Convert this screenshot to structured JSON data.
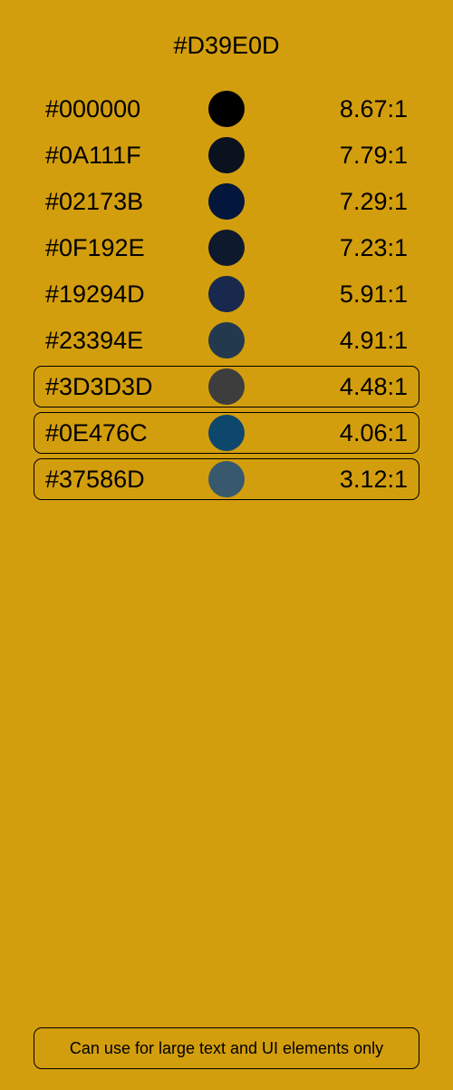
{
  "title": "#D39E0D",
  "background_color": "#D39E0D",
  "rows": [
    {
      "hex": "#000000",
      "color": "#000000",
      "ratio": "8.67:1",
      "outlined": false
    },
    {
      "hex": "#0A111F",
      "color": "#0A111F",
      "ratio": "7.79:1",
      "outlined": false
    },
    {
      "hex": "#02173B",
      "color": "#02173B",
      "ratio": "7.29:1",
      "outlined": false
    },
    {
      "hex": "#0F192E",
      "color": "#0F192E",
      "ratio": "7.23:1",
      "outlined": false
    },
    {
      "hex": "#19294D",
      "color": "#19294D",
      "ratio": "5.91:1",
      "outlined": false
    },
    {
      "hex": "#23394E",
      "color": "#23394E",
      "ratio": "4.91:1",
      "outlined": false
    },
    {
      "hex": "#3D3D3D",
      "color": "#3D3D3D",
      "ratio": "4.48:1",
      "outlined": true
    },
    {
      "hex": "#0E476C",
      "color": "#0E476C",
      "ratio": "4.06:1",
      "outlined": true
    },
    {
      "hex": "#37586D",
      "color": "#37586D",
      "ratio": "3.12:1",
      "outlined": true
    }
  ],
  "footer_note": "Can use for large text and UI elements only"
}
